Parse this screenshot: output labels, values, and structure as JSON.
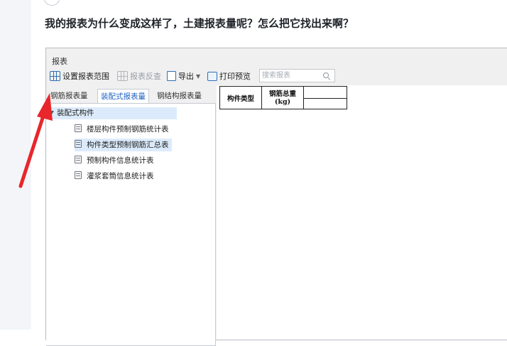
{
  "question": "我的报表为什么变成这样了，土建报表量呢？怎么把它找出来啊？",
  "window": {
    "title": "报表",
    "toolbar": {
      "set_range": "设置报表范围",
      "reverse_check": "报表反查",
      "export": "导出",
      "print_preview": "打印预览",
      "search_placeholder": "搜索报表"
    },
    "tabs": [
      "钢筋报表量",
      "装配式报表量",
      "钢结构报表量"
    ],
    "active_tab_index": 1,
    "tree": {
      "root": "装配式构件",
      "items": [
        "楼层构件预制钢筋统计表",
        "构件类型预制钢筋汇总表",
        "预制构件信息统计表",
        "灌浆套筒信息统计表"
      ],
      "selected_index": 1
    },
    "table": {
      "col1_header": "构件类型",
      "col2_header_line1": "钢筋总重",
      "col2_header_line2": "(kg)"
    }
  },
  "annotation": {
    "arrow_color": "#e8262b"
  },
  "colors": {
    "accent_blue": "#1e62c3",
    "selection_bg": "#dcebfb"
  }
}
